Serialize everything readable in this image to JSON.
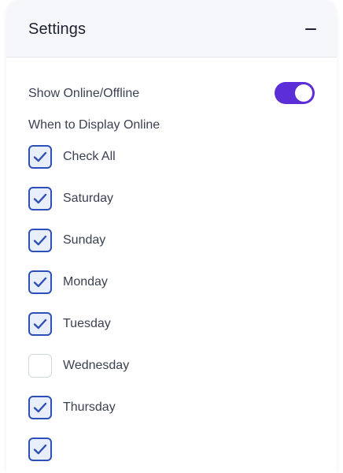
{
  "header": {
    "title": "Settings",
    "collapse_icon": "minus-icon"
  },
  "online_toggle": {
    "label": "Show Online/Offline",
    "on": true,
    "color": "#5b2ed8"
  },
  "display_section": {
    "label": "When to Display Online"
  },
  "days": [
    {
      "label": "Check All",
      "checked": true
    },
    {
      "label": "Saturday",
      "checked": true
    },
    {
      "label": "Sunday",
      "checked": true
    },
    {
      "label": "Monday",
      "checked": true
    },
    {
      "label": "Tuesday",
      "checked": true
    },
    {
      "label": "Wednesday",
      "checked": false
    },
    {
      "label": "Thursday",
      "checked": true
    },
    {
      "label": "",
      "checked": true
    }
  ],
  "colors": {
    "checkbox_border": "#2d4fb8",
    "checkbox_fill": "#e9eefb",
    "header_bg": "#f6f7fa"
  }
}
